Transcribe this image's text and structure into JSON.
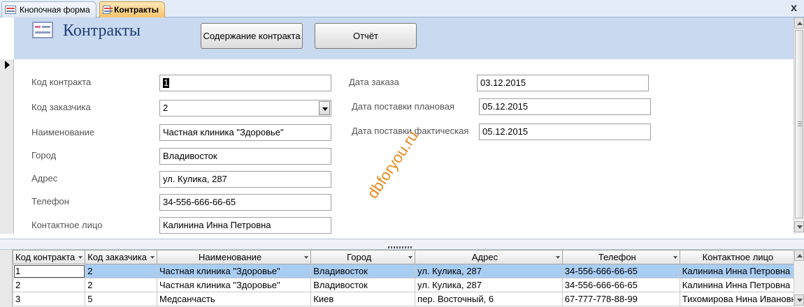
{
  "tabs": [
    {
      "label": "Кнопочная форма",
      "active": false
    },
    {
      "label": "Контракты",
      "active": true
    }
  ],
  "window": {
    "close_glyph": "x"
  },
  "header": {
    "title": "Контракты",
    "btn_contents": "Содержание контракта",
    "btn_report": "Отчёт"
  },
  "form": {
    "contract_code": {
      "label": "Код контракта",
      "value": "1"
    },
    "customer_code": {
      "label": "Код заказчика",
      "value": "2"
    },
    "name": {
      "label": "Наименование",
      "value": "Частная клиника \"Здоровье\""
    },
    "city": {
      "label": "Город",
      "value": "Владивосток"
    },
    "address": {
      "label": "Адрес",
      "value": "ул. Кулика, 287"
    },
    "phone": {
      "label": "Телефон",
      "value": "34-556-666-66-65"
    },
    "contact": {
      "label": "Контактное лицо",
      "value": "Калинина Инна Петровна"
    },
    "order_date": {
      "label": "Дата заказа",
      "value": "03.12.2015"
    },
    "planned_delivery": {
      "label": "Дата поставки плановая",
      "value": "05.12.2015"
    },
    "actual_delivery": {
      "label": "Дата поставки фактическая",
      "value": "05.12.2015"
    }
  },
  "watermark": "dbforyou.ru",
  "datasheet": {
    "columns": [
      "Код контракта",
      "Код заказчика",
      "Наименование",
      "Город",
      "Адрес",
      "Телефон",
      "Контактное лицо"
    ],
    "rows": [
      [
        "1",
        "2",
        "Частная клиника \"Здоровье\"",
        "Владивосток",
        "ул. Кулика, 287",
        "34-556-666-66-65",
        "Калинина Инна Петровна"
      ],
      [
        "2",
        "2",
        "Частная клиника \"Здоровье\"",
        "Владивосток",
        "ул. Кулика, 287",
        "34-556-666-66-65",
        "Калинина Инна Петровна"
      ],
      [
        "3",
        "5",
        "Медсанчасть",
        "Киев",
        "пер. Восточный, 6",
        "67-777-778-88-99",
        "Тихомирова Нина Ивановна"
      ]
    ],
    "selected_row": 0
  },
  "colors": {
    "header_bg": "#c9d9f0",
    "title": "#1f3f78",
    "selected_row": "#a9cdf2",
    "active_tab": "#f8c46a",
    "watermark": "#e58a1f"
  }
}
